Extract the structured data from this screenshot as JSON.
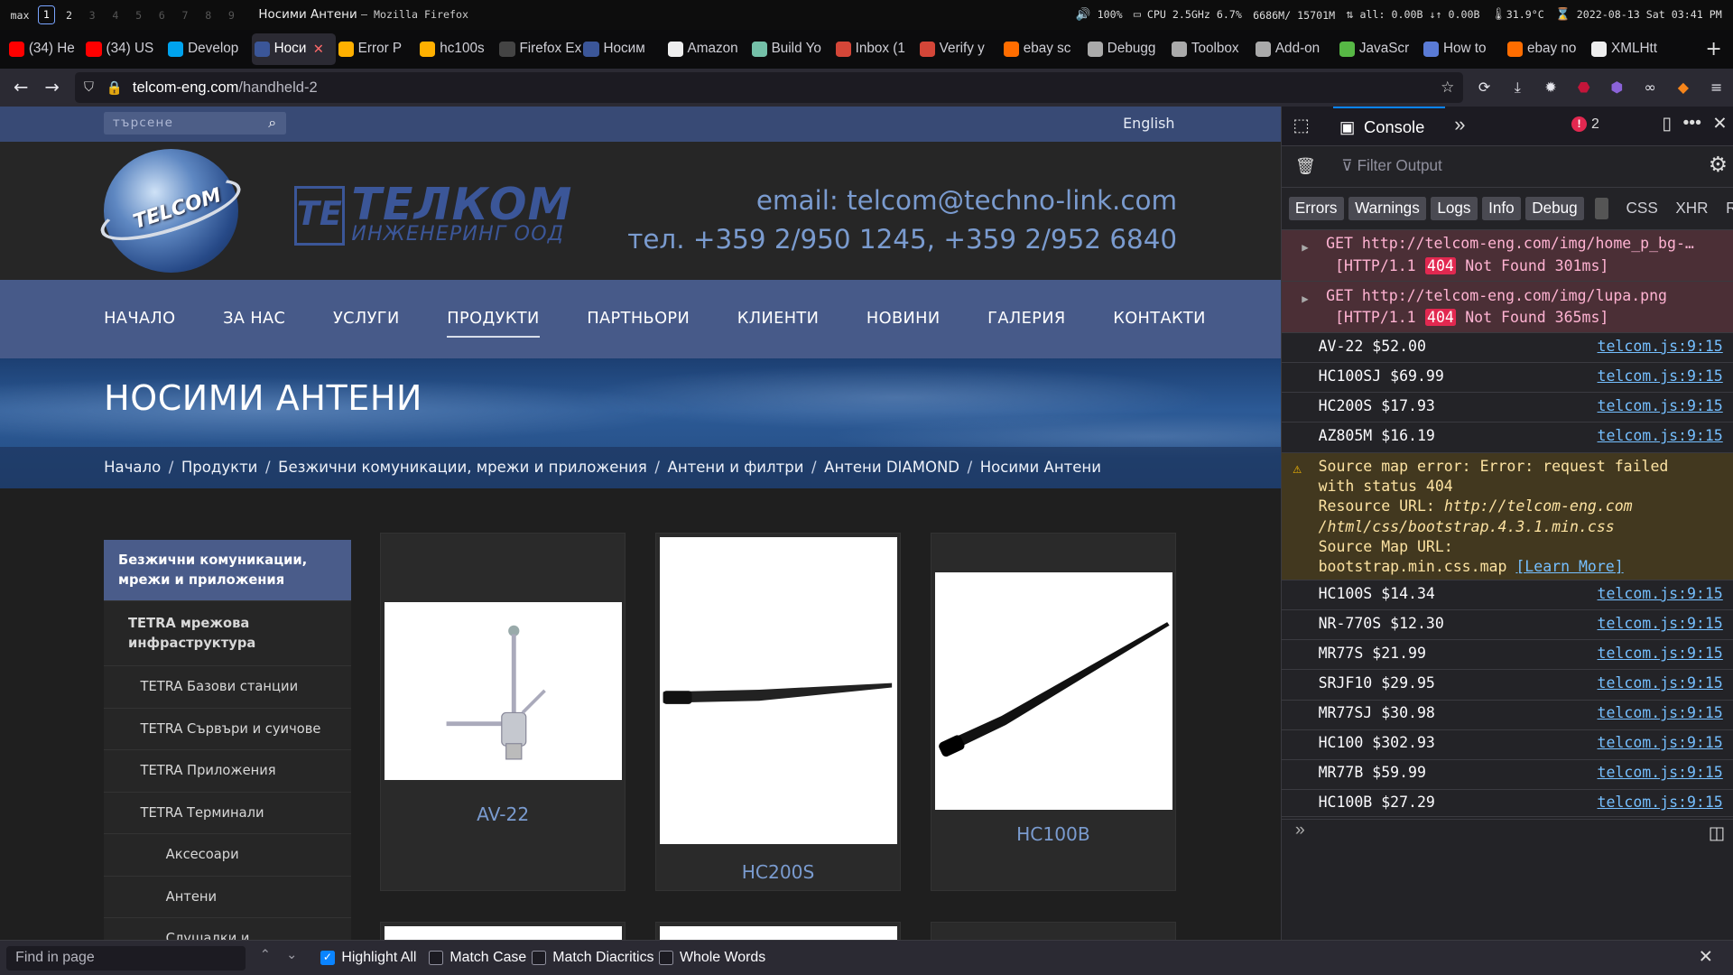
{
  "wm": {
    "label": "max",
    "workspaces": [
      "1",
      "2",
      "3",
      "4",
      "5",
      "6",
      "7",
      "8",
      "9"
    ],
    "active_workspace": "1",
    "window_title": "Носими Антени",
    "window_app": "– Mozilla Firefox",
    "volume": "100%",
    "cpu": "CPU 2.5GHz 6.7%",
    "mem": "6686M/ 15701M",
    "net": "all:  0.00B ↓↑  0.00B",
    "temp": "31.9°C",
    "datetime": "2022-08-13 Sat 03:41 PM"
  },
  "tabs": [
    {
      "label": "(34) He",
      "color": "#ff0000"
    },
    {
      "label": "(34) US",
      "color": "#ff0000"
    },
    {
      "label": "Develop",
      "color": "#00a3ee"
    },
    {
      "label": "Носи",
      "color": "#3b5698",
      "active": true
    },
    {
      "label": "Error P",
      "color": "#ffb000"
    },
    {
      "label": "hc100s",
      "color": "#ffb000"
    },
    {
      "label": "Firefox Ext",
      "color": "#444"
    },
    {
      "label": "Носим",
      "color": "#3b5698"
    },
    {
      "label": "Amazon",
      "color": "#eee"
    },
    {
      "label": "Build Yo",
      "color": "#74c0a8"
    },
    {
      "label": "Inbox (1",
      "color": "#d44638"
    },
    {
      "label": "Verify y",
      "color": "#d44638"
    },
    {
      "label": "ebay sc",
      "color": "#ff6d00"
    },
    {
      "label": "Debugg",
      "color": "#aaa"
    },
    {
      "label": "Toolbox",
      "color": "#aaa"
    },
    {
      "label": "Add-on",
      "color": "#aaa"
    },
    {
      "label": "JavaScr",
      "color": "#57b845"
    },
    {
      "label": "How to",
      "color": "#5a7bd6"
    },
    {
      "label": "ebay no",
      "color": "#ff6d00"
    },
    {
      "label": "XMLHtt",
      "color": "#eee"
    }
  ],
  "nav": {
    "url_host": "telcom-eng.com",
    "url_path": "/handheld-2"
  },
  "site": {
    "search_placeholder": "търсене",
    "language": "English",
    "logo_globe_text": "TELCOM",
    "brand_mark": "TE",
    "brand_name": "ТЕЛКОМ",
    "brand_sub": "ИНЖЕНЕРИНГ ООД",
    "email": "email: telcom@techno-link.com",
    "phone": "тел. +359 2/950 1245, +359 2/952 6840",
    "menu": [
      "НАЧАЛО",
      "ЗА НАС",
      "УСЛУГИ",
      "ПРОДУКТИ",
      "ПАРТНЬОРИ",
      "КЛИЕНТИ",
      "НОВИНИ",
      "ГАЛЕРИЯ",
      "КОНТАКТИ"
    ],
    "active_menu": "ПРОДУКТИ",
    "page_title": "НОСИМИ АНТЕНИ",
    "breadcrumb": [
      "Начало",
      "Продукти",
      "Безжични комуникации, мрежи и приложения",
      "Антени и филтри",
      "Антени DIAMOND",
      "Носими Антени"
    ],
    "sidebar": [
      {
        "label": "Безжични комуникации, мрежи и приложения",
        "level": "hd"
      },
      {
        "label": "TETRA мрежова инфраструктура",
        "level": "l1"
      },
      {
        "label": "TETRA Базови станции",
        "level": "l2"
      },
      {
        "label": "TETRA Сървъри и суичове",
        "level": "l2"
      },
      {
        "label": "TETRA Приложения",
        "level": "l2"
      },
      {
        "label": "TETRA Терминали",
        "level": "l2"
      },
      {
        "label": "Аксесоари",
        "level": "l3"
      },
      {
        "label": "Антени",
        "level": "l3"
      },
      {
        "label": "Слушалки и",
        "level": "l3"
      }
    ],
    "products": [
      "AV-22",
      "HC200S",
      "HC100B"
    ]
  },
  "devtools": {
    "tab_console": "Console",
    "error_count": "2",
    "filter_placeholder": "Filter Output",
    "levels": [
      "Errors",
      "Warnings",
      "Logs",
      "Info",
      "Debug"
    ],
    "types": [
      "CSS",
      "XHR",
      "R"
    ],
    "errors": [
      {
        "line1": "GET http://telcom-eng.com/img/home_p_bg-…",
        "proto": "[HTTP/1.1",
        "code": "404",
        "tail": "Not Found 301ms]"
      },
      {
        "line1": "GET http://telcom-eng.com/img/lupa.png",
        "proto": "[HTTP/1.1",
        "code": "404",
        "tail": "Not Found 365ms]"
      }
    ],
    "logs_before": [
      "AV-22 $52.00",
      "HC100SJ $69.99",
      "HC200S $17.93",
      "AZ805M $16.19"
    ],
    "warning": {
      "l1": "Source map error: Error: request failed",
      "l2": "with status 404",
      "l3": "Resource URL: ",
      "l3i": "http://telcom-eng.com",
      "l4i": "/html/css/bootstrap.4.3.1.min.css",
      "l5": "Source Map URL:",
      "l6": "bootstrap.min.css.map ",
      "learn": "[Learn More]"
    },
    "logs_after": [
      "HC100S $14.34",
      "NR-770S $12.30",
      "MR77S  $21.99",
      "SRJF10 $29.95",
      "MR77SJ $30.98",
      "HC100 $302.93",
      "MR77B $59.99",
      "HC100B $27.29"
    ],
    "source": "telcom.js:9:15"
  },
  "find": {
    "placeholder": "Find in page",
    "highlight_all": "Highlight All",
    "match_case": "Match Case",
    "match_diacritics": "Match Diacritics",
    "whole_words": "Whole Words"
  }
}
